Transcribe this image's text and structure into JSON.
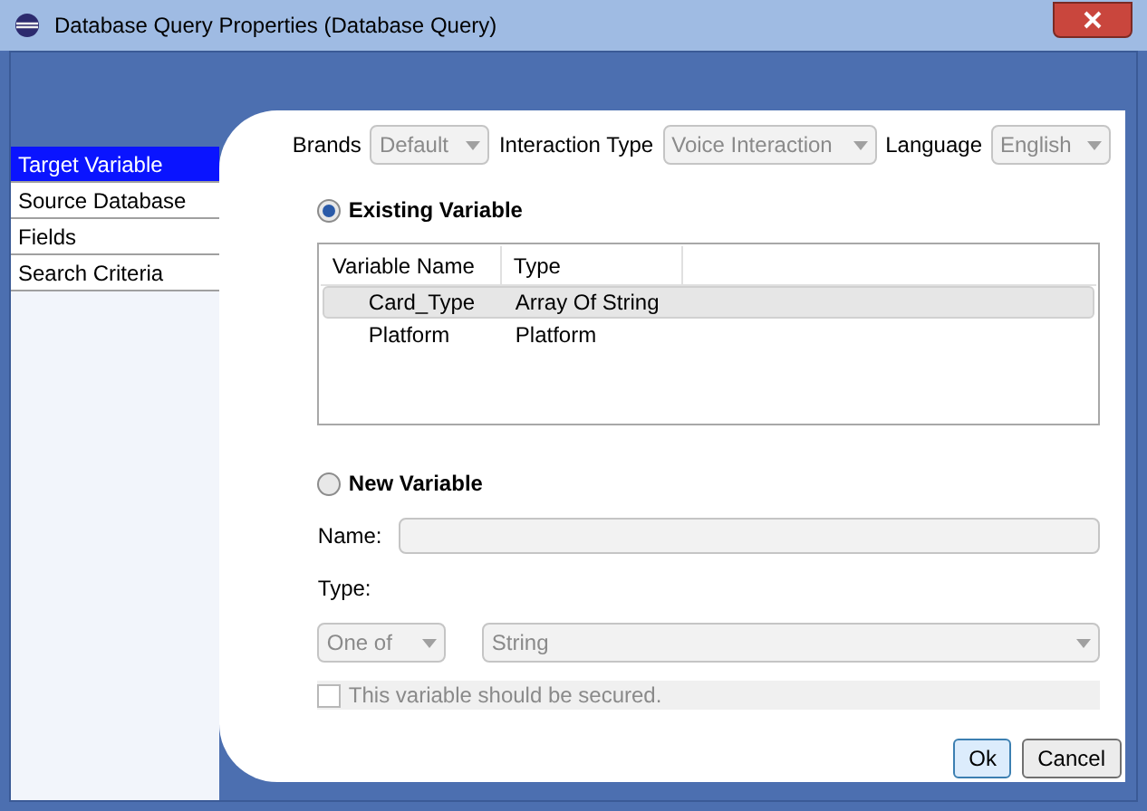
{
  "window": {
    "title": "Database Query Properties (Database Query)"
  },
  "sidebar": {
    "items": [
      {
        "label": "Target Variable",
        "selected": true
      },
      {
        "label": "Source Database",
        "selected": false
      },
      {
        "label": "Fields",
        "selected": false
      },
      {
        "label": "Search Criteria",
        "selected": false
      }
    ]
  },
  "filters": [
    {
      "label": "Brands",
      "value": "Default"
    },
    {
      "label": "Interaction Type",
      "value": "Voice Interaction"
    },
    {
      "label": "Language",
      "value": "English"
    }
  ],
  "existing_variable": {
    "label": "Existing Variable",
    "selected": true
  },
  "table": {
    "columns": [
      "Variable Name",
      "Type"
    ],
    "rows": [
      {
        "cells": [
          "Card_Type",
          "Array Of String"
        ],
        "selected": true
      },
      {
        "cells": [
          "Platform",
          "Platform"
        ],
        "selected": false
      }
    ]
  },
  "new_variable": {
    "label": "New Variable",
    "selected": false
  },
  "name_field": {
    "label": "Name:"
  },
  "type_label": "Type:",
  "type_mode": {
    "value": "One of"
  },
  "type_value": {
    "value": "String"
  },
  "secured": {
    "label": "This variable should be secured.",
    "checked": false,
    "disabled": true
  },
  "buttons": [
    "Ok",
    "Cancel"
  ]
}
